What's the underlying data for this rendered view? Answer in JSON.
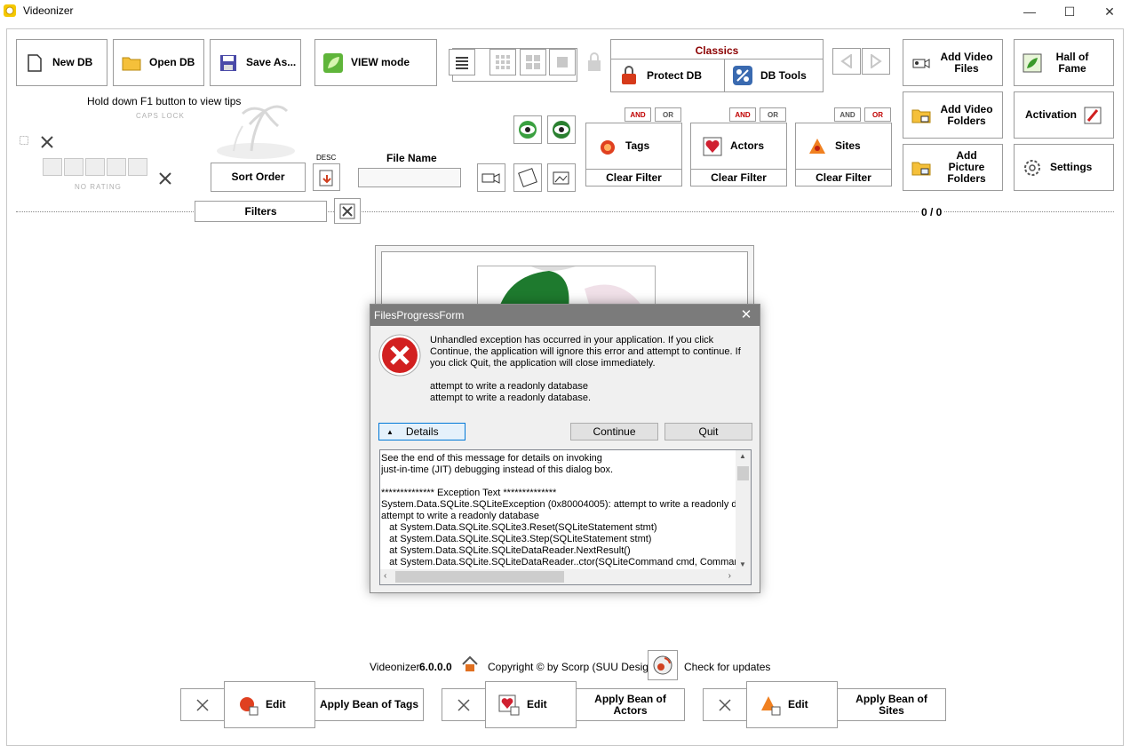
{
  "window": {
    "title": "Videonizer",
    "minimize": "—",
    "maximize": "☐",
    "close": "✕"
  },
  "toolbar": {
    "new_db": "New DB",
    "open_db": "Open DB",
    "save_as": "Save As...",
    "view_mode": "VIEW mode",
    "classics": "Classics",
    "protect_db": "Protect DB",
    "db_tools": "DB Tools",
    "add_video_files": "Add Video Files",
    "hall_of_fame": "Hall of Fame",
    "add_video_folders": "Add Video Folders",
    "activation": "Activation",
    "add_picture_folders": "Add Picture Folders",
    "settings": "Settings"
  },
  "tips": {
    "hold_f1": "Hold down F1 button to view tips",
    "caps_lock": "CAPS LOCK",
    "no_rating": "NO RATING"
  },
  "sort": {
    "sort_order": "Sort Order",
    "desc": "DESC",
    "file_name_label": "File Name",
    "file_name_value": ""
  },
  "filters": {
    "filters_label": "Filters",
    "counter": "0 / 0",
    "and": "AND",
    "or": "OR",
    "tags": "Tags",
    "actors": "Actors",
    "sites": "Sites",
    "clear_filter": "Clear Filter"
  },
  "footer": {
    "app_name": "Videonizer",
    "version": "6.0.0.0",
    "copyright": "Copyright © by Scorp (SUU Design)",
    "check_updates": "Check for updates",
    "edit": "Edit",
    "apply_tags": "Apply Bean of Tags",
    "apply_actors": "Apply Bean of Actors",
    "apply_sites": "Apply Bean of Sites"
  },
  "dialog": {
    "title": "FilesProgressForm",
    "message_line1": "Unhandled exception has occurred in your application. If you click",
    "message_line2": "Continue, the application will ignore this error and attempt to continue. If",
    "message_line3": "you click Quit, the application will close immediately.",
    "error_line1": "attempt to write a readonly database",
    "error_line2": "attempt to write a readonly database.",
    "details_button": "Details",
    "continue_button": "Continue",
    "quit_button": "Quit",
    "details_text": "See the end of this message for details on invoking\njust-in-time (JIT) debugging instead of this dialog box.\n\n************** Exception Text **************\nSystem.Data.SQLite.SQLiteException (0x80004005): attempt to write a readonly database\nattempt to write a readonly database\n   at System.Data.SQLite.SQLite3.Reset(SQLiteStatement stmt)\n   at System.Data.SQLite.SQLite3.Step(SQLiteStatement stmt)\n   at System.Data.SQLite.SQLiteDataReader.NextResult()\n   at System.Data.SQLite.SQLiteDataReader..ctor(SQLiteCommand cmd, CommandBehavior behave)"
  },
  "colors": {
    "accent_red": "#c00000",
    "dialog_title": "#7b7b7b",
    "error_red": "#d22020"
  }
}
